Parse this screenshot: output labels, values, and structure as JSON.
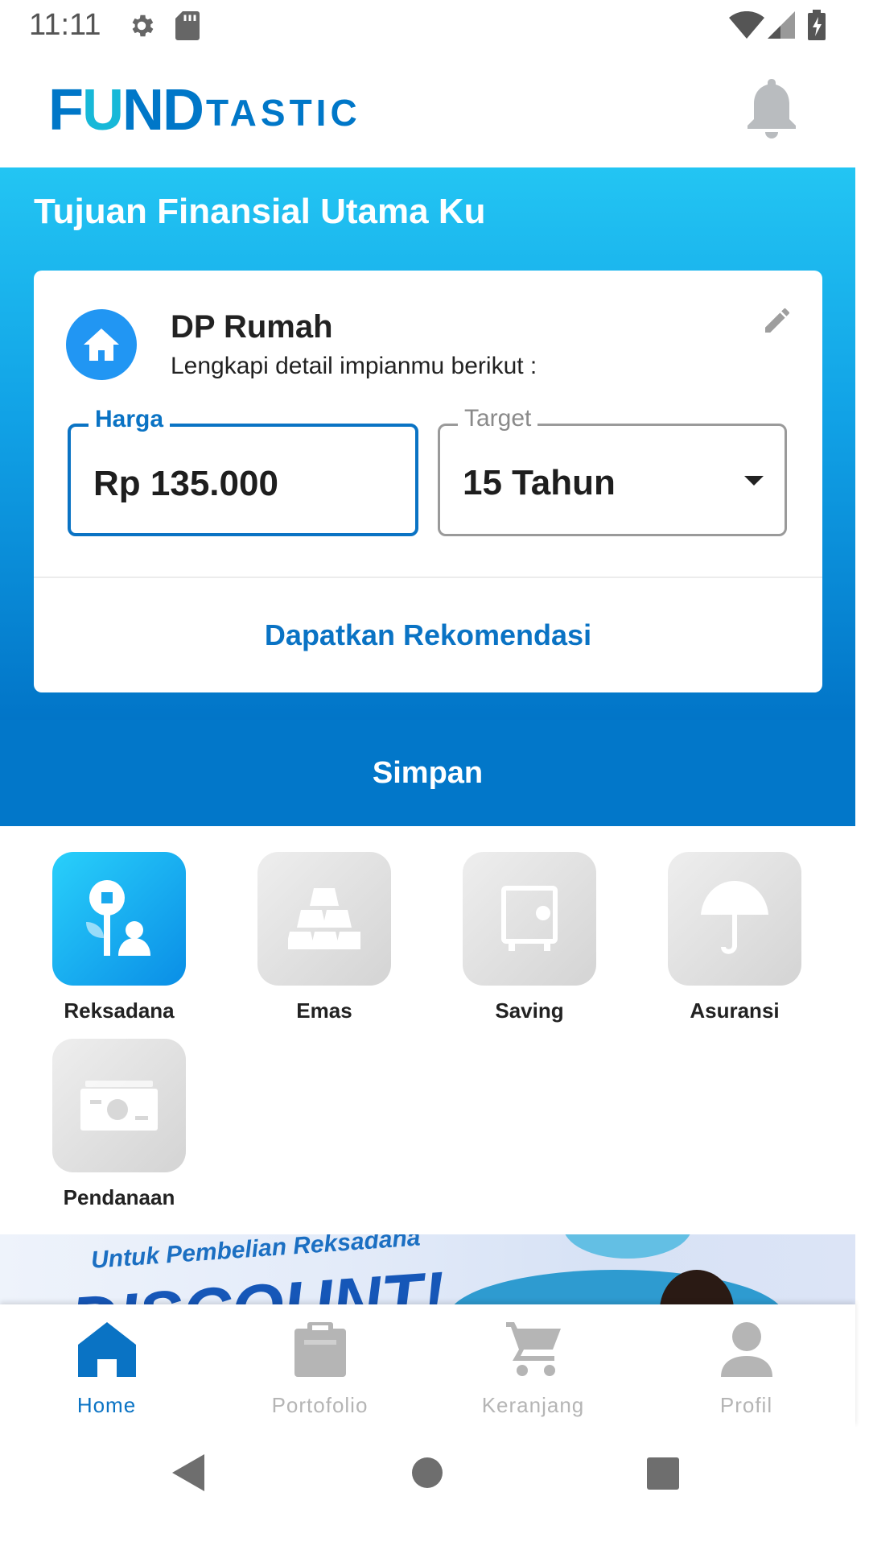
{
  "status_bar": {
    "time": "11:11",
    "icons": [
      "gear-icon",
      "sd-card-icon",
      "wifi-icon",
      "signal-icon",
      "battery-charging-icon"
    ]
  },
  "header": {
    "logo_fund_f": "F",
    "logo_fund_u": "U",
    "logo_fund_nd": "ND",
    "logo_tastic": "TASTIC",
    "notification_icon": "bell-icon"
  },
  "colors": {
    "primary": "#0277c9",
    "accent": "#23c5f3",
    "inactive": "#b5b5b5"
  },
  "goal": {
    "section_title": "Tujuan Finansial Utama Ku",
    "name": "DP Rumah",
    "subtitle": "Lengkapi detail impianmu berikut :",
    "icon": "home-icon",
    "price_label": "Harga",
    "price_value": "Rp 135.000",
    "target_label": "Target",
    "target_value": "15 Tahun",
    "recommend_button": "Dapatkan Rekomendasi"
  },
  "save_button": "Simpan",
  "products": [
    {
      "label": "Reksadana",
      "icon": "mutual-fund-icon",
      "selected": true
    },
    {
      "label": "Emas",
      "icon": "gold-bars-icon",
      "selected": false
    },
    {
      "label": "Saving",
      "icon": "safe-icon",
      "selected": false
    },
    {
      "label": "Asuransi",
      "icon": "umbrella-icon",
      "selected": false
    },
    {
      "label": "Pendanaan",
      "icon": "banknote-icon",
      "selected": false
    }
  ],
  "banner": {
    "line1": "Untuk Pembelian Reksadana",
    "line2": "DISCOUNT!"
  },
  "bottom_nav": [
    {
      "label": "Home",
      "icon": "home-icon",
      "active": true
    },
    {
      "label": "Portofolio",
      "icon": "clipboard-icon",
      "active": false
    },
    {
      "label": "Keranjang",
      "icon": "cart-icon",
      "active": false
    },
    {
      "label": "Profil",
      "icon": "person-icon",
      "active": false
    }
  ]
}
